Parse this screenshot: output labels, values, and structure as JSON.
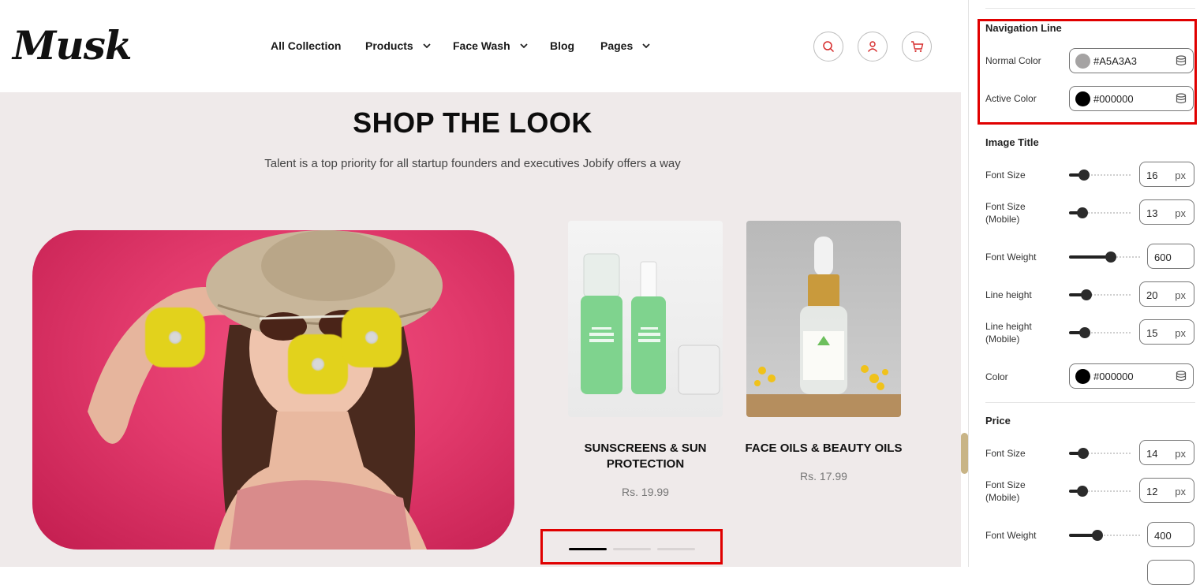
{
  "header": {
    "logo": "Musk",
    "nav": [
      {
        "label": "All Collection",
        "has_dropdown": false
      },
      {
        "label": "Products",
        "has_dropdown": true
      },
      {
        "label": "Face Wash",
        "has_dropdown": true
      },
      {
        "label": "Blog",
        "has_dropdown": false
      },
      {
        "label": "Pages",
        "has_dropdown": true
      }
    ],
    "icons": [
      "search-icon",
      "user-icon",
      "cart-icon"
    ]
  },
  "section": {
    "title": "SHOP THE LOOK",
    "subtitle": "Talent is a top priority for all startup founders and executives Jobify offers a way",
    "products": [
      {
        "title": "SUNSCREENS & SUN PROTECTION",
        "price": "Rs. 19.99"
      },
      {
        "title": "FACE OILS & BEAUTY OILS",
        "price": "Rs. 17.99"
      }
    ],
    "carousel": {
      "active_index": 0,
      "count": 3
    }
  },
  "panel": {
    "navigation_line": {
      "heading": "Navigation Line",
      "normal_label": "Normal Color",
      "normal_value": "#A5A3A3",
      "active_label": "Active Color",
      "active_value": "#000000"
    },
    "image_title": {
      "heading": "Image Title",
      "rows": [
        {
          "label": "Font Size",
          "value": "16",
          "unit": "px",
          "fraction": 0.18
        },
        {
          "label": "Font Size (Mobile)",
          "value": "13",
          "unit": "px",
          "fraction": 0.15
        },
        {
          "label": "Font Weight",
          "value": "600",
          "unit": "",
          "fraction": 0.6
        },
        {
          "label": "Line height",
          "value": "20",
          "unit": "px",
          "fraction": 0.22
        },
        {
          "label": "Line height (Mobile)",
          "value": "15",
          "unit": "px",
          "fraction": 0.2
        }
      ],
      "color_label": "Color",
      "color_value": "#000000"
    },
    "price": {
      "heading": "Price",
      "rows": [
        {
          "label": "Font Size",
          "value": "14",
          "unit": "px",
          "fraction": 0.17
        },
        {
          "label": "Font Size (Mobile)",
          "value": "12",
          "unit": "px",
          "fraction": 0.15
        },
        {
          "label": "Font Weight",
          "value": "400",
          "unit": "",
          "fraction": 0.38
        }
      ]
    }
  },
  "colors": {
    "accent_red": "#e00000",
    "hero_pink": "#e23a6c",
    "hotspot_yellow": "#e2d21c",
    "section_bg": "#efeaea",
    "nav_active": "#000000",
    "nav_inactive": "#d9d4d4"
  }
}
